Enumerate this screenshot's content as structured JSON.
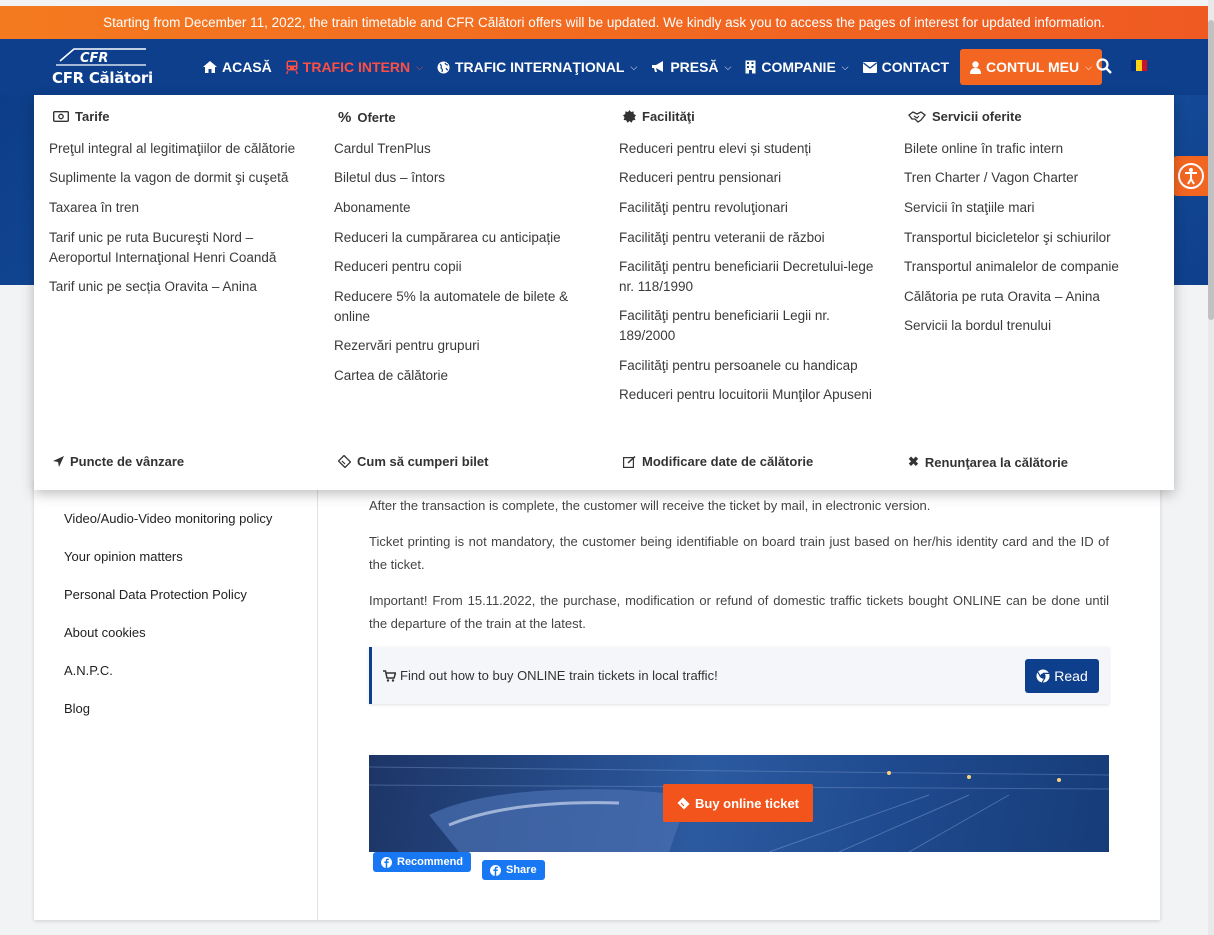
{
  "announcement": "Starting from December 11, 2022, the train timetable and CFR Călători offers will be updated. We kindly ask you to access the pages of interest for updated information.",
  "logo": {
    "mark": "CFR",
    "name": "CFR Călători"
  },
  "nav": {
    "home": "ACASĂ",
    "domestic": "TRAFIC INTERN",
    "international": "TRAFIC INTERNAŢIONAL",
    "press": "PRESĂ",
    "company": "COMPANIE",
    "contact": "CONTACT",
    "account": "CONTUL MEU"
  },
  "colors": {
    "brand_blue": "#0e3f8c",
    "accent_orange": "#f36621",
    "active_red": "#ff4e43",
    "facebook": "#1877f2"
  },
  "mega": {
    "columns": [
      {
        "title": "Tarife",
        "icon": "money-icon",
        "links": [
          "Preţul integral al legitimaţiilor de călătorie",
          "Suplimente la vagon de dormit şi cuşetă",
          "Taxarea în tren",
          "Tarif unic pe ruta Bucureşti Nord – Aeroportul Internaţional Henri Coandă",
          "Tarif unic pe secția Oravita – Anina"
        ]
      },
      {
        "title": "Oferte",
        "icon": "percent-icon",
        "links": [
          "Cardul TrenPlus",
          "Biletul dus – întors",
          "Abonamente",
          "Reduceri la cumpărarea cu anticipație",
          "Reduceri pentru copii",
          "Reducere 5% la automatele de bilete & online",
          "Rezervări pentru grupuri",
          "Cartea de călătorie"
        ]
      },
      {
        "title": "Facilităţi",
        "icon": "certificate-icon",
        "links": [
          "Reduceri pentru elevi și studenți",
          "Reduceri pentru pensionari",
          "Facilităţi pentru revoluţionari",
          "Facilităţi pentru veteranii de război",
          "Facilităţi pentru beneficiarii Decretului-lege nr. 118/1990",
          "Facilităţi pentru beneficiarii Legii nr. 189/2000",
          "Facilităţi pentru persoanele cu handicap",
          "Reduceri pentru locuitorii Munţilor Apuseni"
        ]
      },
      {
        "title": "Servicii oferite",
        "icon": "handshake-icon",
        "links": [
          "Bilete online în trafic intern",
          "Tren Charter / Vagon Charter",
          "Servicii în staţiile mari",
          "Transportul bicicletelor şi schiurilor",
          "Transportul animalelor de companie",
          "Călătoria pe ruta Oravita – Anina",
          "Servicii la bordul trenului"
        ]
      }
    ],
    "footer": [
      "Puncte de vânzare",
      "Cum să cumperi bilet",
      "Modificare date de călătorie",
      "Renunţarea la călătorie"
    ]
  },
  "sidebar": {
    "links": [
      "Video/Audio-Video monitoring policy",
      "Your opinion matters",
      "Personal Data Protection Policy",
      "About cookies",
      "A.N.P.C.",
      "Blog"
    ]
  },
  "main": {
    "paragraphs": [
      "After the transaction is complete, the customer will receive the ticket by mail, in electronic version.",
      "Ticket printing is not mandatory, the customer being identifiable on board train just based on her/his identity card and the ID of the ticket.",
      "Important! From 15.11.2022, the purchase, modification or refund of domestic traffic tickets bought ONLINE can be done until the departure of the train at the latest."
    ],
    "callout_text": "Find out how to buy ONLINE train tickets  in local traffic!",
    "read_label": "Read",
    "buy_label": "Buy online ticket",
    "fb_recommend": "Recommend",
    "fb_share": "Share"
  }
}
